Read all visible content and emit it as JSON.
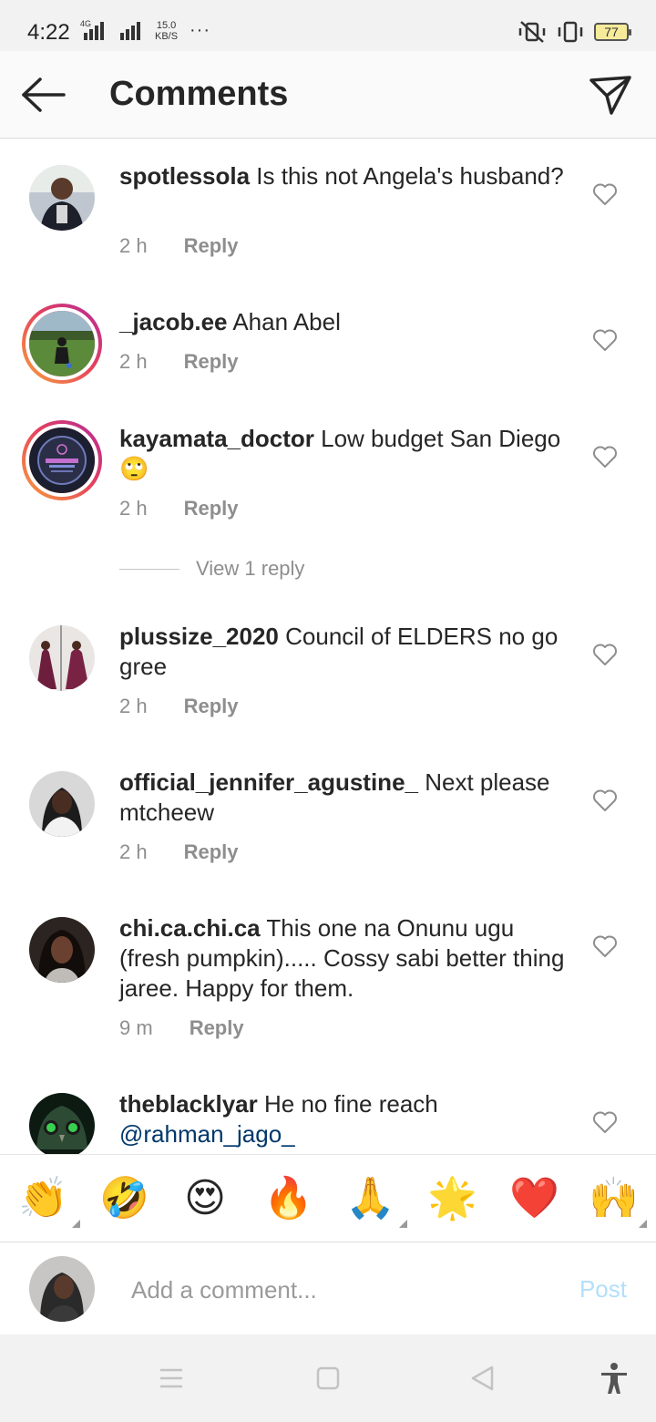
{
  "status_bar": {
    "time": "4:22",
    "network": "4G",
    "speed_value": "15.0",
    "speed_unit": "KB/S",
    "more": "···",
    "battery": "77"
  },
  "header": {
    "title": "Comments",
    "back_icon": "arrow-left-icon",
    "send_icon": "paper-plane-icon"
  },
  "comments": [
    {
      "username": "spotlessola",
      "text": "Is this not Angela's husband?",
      "time": "2 h",
      "reply": "Reply",
      "story_ring": false
    },
    {
      "username": "_jacob.ee",
      "text": "Ahan Abel",
      "time": "2 h",
      "reply": "Reply",
      "story_ring": true
    },
    {
      "username": "kayamata_doctor",
      "text": "Low budget San Diego 🙄",
      "time": "2 h",
      "reply": "Reply",
      "story_ring": true
    },
    {
      "username": "plussize_2020",
      "text": "Council of ELDERS no go gree",
      "time": "2 h",
      "reply": "Reply",
      "story_ring": false
    },
    {
      "username": "official_jennifer_agustine_",
      "text": "Next please mtcheew",
      "time": "2 h",
      "reply": "Reply",
      "story_ring": false
    },
    {
      "username": "chi.ca.chi.ca",
      "text": "This one na Onunu ugu (fresh pumpkin)..... Cossy sabi better thing jaree. Happy for them.",
      "time": "9 m",
      "reply": "Reply",
      "story_ring": false
    },
    {
      "username": "theblacklyar",
      "text": "He no fine reach",
      "mention": "@rahman_jago_",
      "story_ring": false
    }
  ],
  "view_replies": "View 1 reply",
  "emoji_bar": [
    "👏",
    "🤣",
    "😍",
    "🔥",
    "🙏",
    "🌟",
    "❤️",
    "🙌"
  ],
  "composer": {
    "placeholder": "Add a comment...",
    "post_label": "Post"
  },
  "colors": {
    "link": "#00376b",
    "post_disabled": "#b2dffc",
    "story_ring_start": "#f9a33b",
    "story_ring_end": "#b22a9b"
  }
}
